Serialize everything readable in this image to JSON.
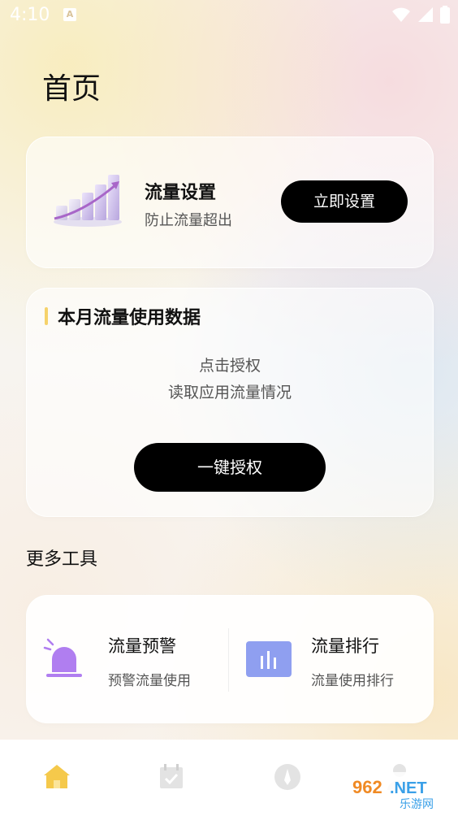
{
  "status": {
    "time": "4:10",
    "notification_glyph": "A"
  },
  "page": {
    "title": "首页"
  },
  "traffic_settings": {
    "title": "流量设置",
    "subtitle": "防止流量超出",
    "button_label": "立即设置"
  },
  "monthly_data": {
    "title": "本月流量使用数据",
    "line1": "点击授权",
    "line2": "读取应用流量情况",
    "button_label": "一键授权"
  },
  "more_tools": {
    "title": "更多工具",
    "items": [
      {
        "title": "流量预警",
        "subtitle": "预警流量使用",
        "icon": "alarm-light-icon"
      },
      {
        "title": "流量排行",
        "subtitle": "流量使用排行",
        "icon": "bar-chart-icon"
      }
    ]
  },
  "nav": {
    "items": [
      {
        "icon": "home-icon",
        "active": true
      },
      {
        "icon": "calendar-icon",
        "active": false
      },
      {
        "icon": "compass-icon",
        "active": false
      },
      {
        "icon": "profile-icon",
        "active": false
      }
    ]
  },
  "watermark": {
    "brand_text": "962.NET",
    "sub_text": "乐游网"
  },
  "colors": {
    "accent_yellow": "#f5d26b",
    "nav_active": "#f5c94b",
    "button_black": "#000000",
    "alarm_purple": "#b07ef0",
    "chart_blue": "#8f9ff0"
  }
}
